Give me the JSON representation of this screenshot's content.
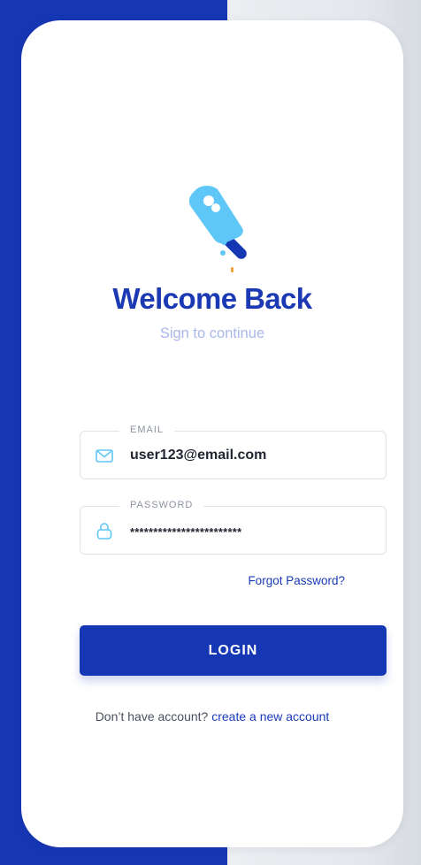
{
  "colors": {
    "primary": "#1637b4",
    "accent_icon": "#5ec7f7",
    "subtitle": "#a9b8ec",
    "background_right": "#e9ebef",
    "card": "#ffffff"
  },
  "header": {
    "logo_icon": "popsicle-icon",
    "title": "Welcome Back",
    "subtitle": "Sign to continue"
  },
  "form": {
    "email": {
      "label": "EMAIL",
      "value": "user123@email.com",
      "icon": "envelope-icon"
    },
    "password": {
      "label": "PASSWORD",
      "value": "************************",
      "icon": "lock-icon"
    },
    "forgot_password": "Forgot Password?",
    "login_label": "LOGIN"
  },
  "footer": {
    "prompt": "Don’t have account?",
    "link": "create a new account"
  }
}
